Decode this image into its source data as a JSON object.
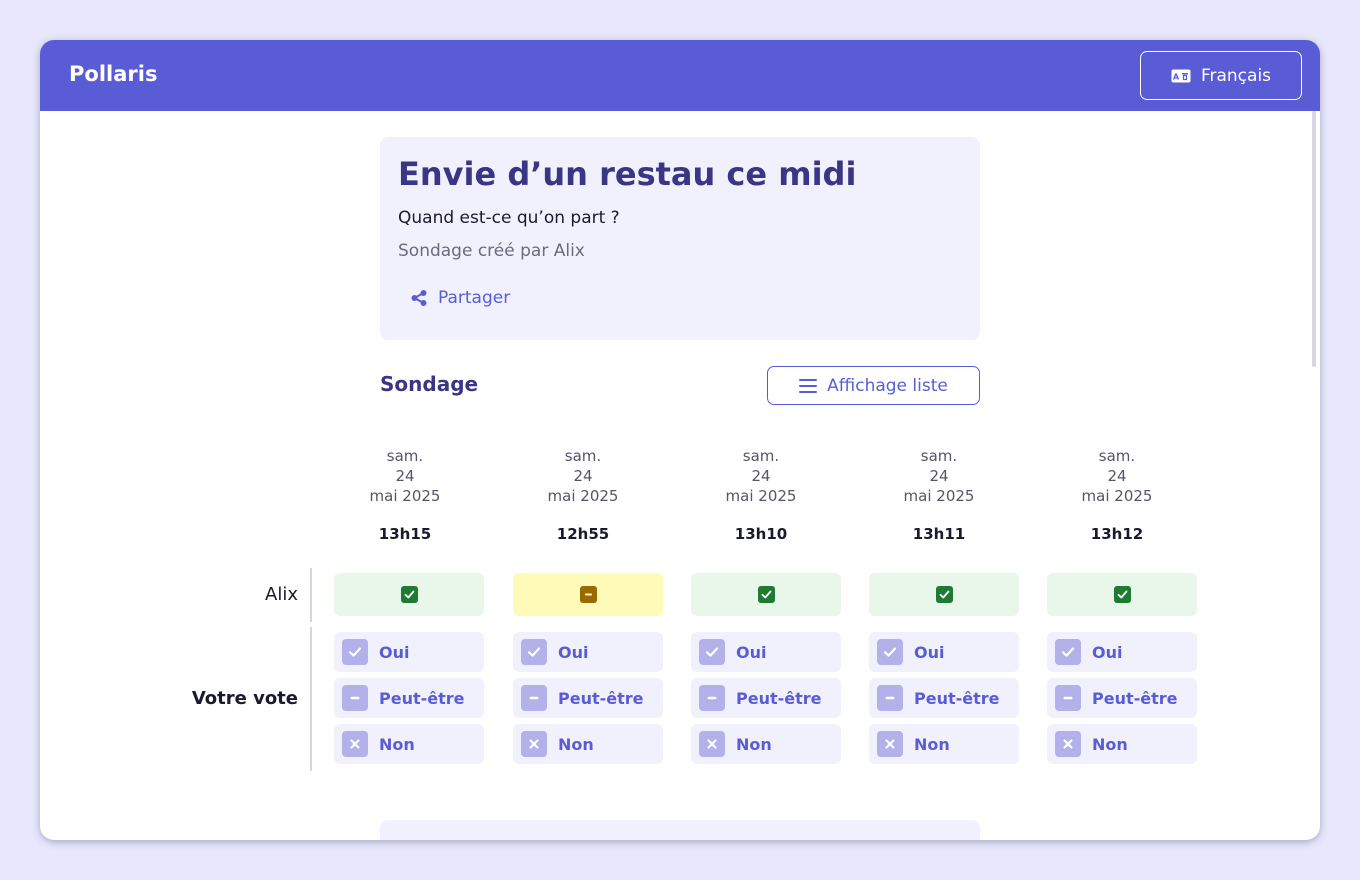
{
  "app": {
    "brand": "Pollaris",
    "language_label": "Français",
    "language_icon": "language-icon"
  },
  "poll": {
    "title": "Envie d’un restau ce midi",
    "question": "Quand est-ce qu’on part ?",
    "author_line": "Sondage créé par Alix",
    "share_label": "Partager",
    "share_icon": "share-icon"
  },
  "section": {
    "title": "Sondage",
    "list_view_label": "Affichage liste",
    "list_icon": "list-icon"
  },
  "columns": [
    {
      "day": "sam.",
      "date": "24",
      "month": "mai 2025",
      "time": "13h15"
    },
    {
      "day": "sam.",
      "date": "24",
      "month": "mai 2025",
      "time": "12h55"
    },
    {
      "day": "sam.",
      "date": "24",
      "month": "mai 2025",
      "time": "13h10"
    },
    {
      "day": "sam.",
      "date": "24",
      "month": "mai 2025",
      "time": "13h11"
    },
    {
      "day": "sam.",
      "date": "24",
      "month": "mai 2025",
      "time": "13h12"
    }
  ],
  "participants": [
    {
      "name": "Alix",
      "votes": [
        "yes",
        "maybe",
        "yes",
        "yes",
        "yes"
      ]
    }
  ],
  "your_vote": {
    "label": "Votre vote",
    "options": [
      "Oui",
      "Peut-être",
      "Non"
    ]
  },
  "colors": {
    "accent": "#5a5cd6",
    "title": "#3b3585",
    "yes_bg": "#e8f7ea",
    "yes_badge": "#1f7a34",
    "maybe_bg": "#fefbb9",
    "maybe_badge": "#9a6a00"
  }
}
